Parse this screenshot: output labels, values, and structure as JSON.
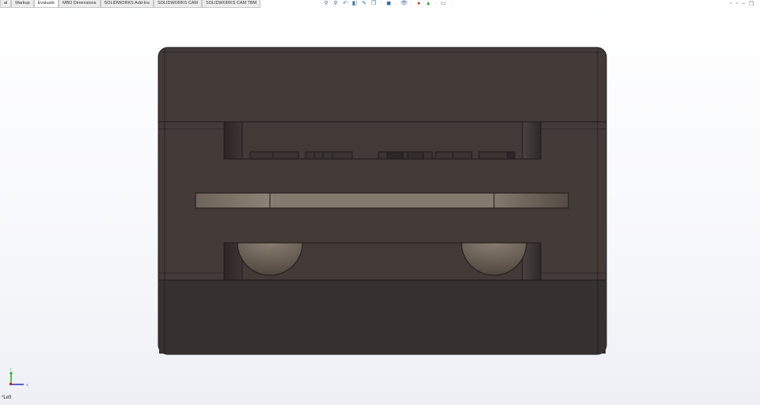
{
  "tabs": [
    {
      "label": "al"
    },
    {
      "label": "Markup"
    },
    {
      "label": "Evaluate",
      "active": true
    },
    {
      "label": "MBD Dimensions"
    },
    {
      "label": "SOLIDWORKS Add-Ins"
    },
    {
      "label": "SOLIDWORKS CAM"
    },
    {
      "label": "SOLIDWORKS CAM TBM"
    }
  ],
  "toolbar_icons": [
    "zoom-to-fit-icon",
    "zoom-to-area-icon",
    "previous-view-icon",
    "section-view-icon",
    "dynamic-annotation-icon",
    "view-orientation-icon",
    "display-style-icon",
    "hide-show-icon",
    "edit-appearance-icon",
    "apply-scene-icon",
    "view-settings-icon"
  ],
  "window_controls": [
    "restore-pane-icon",
    "restore-pane-icon",
    "minimize-icon",
    "restore-icon"
  ],
  "triad": {
    "x_label": "X",
    "y_label": "Y"
  },
  "view_label": "*Left",
  "colors": {
    "body": "#433b38",
    "body_dark": "#353030",
    "edge": "#1e1b1a",
    "bar": "#857a6e",
    "x_axis": "#2233cc",
    "y_axis": "#22aa22"
  }
}
